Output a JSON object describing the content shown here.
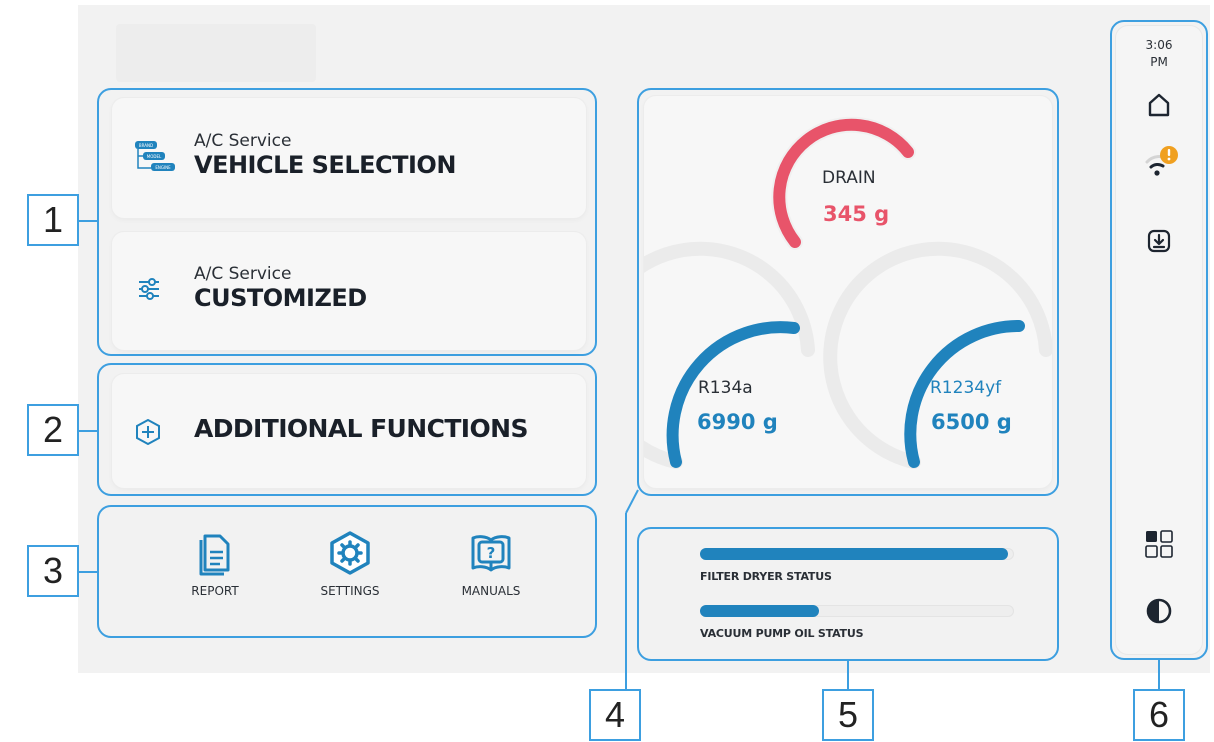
{
  "vehicle_selection": {
    "subtitle": "A/C Service",
    "title": "VEHICLE SELECTION",
    "icon": "vehicle-database-icon",
    "icon_tags": [
      "BRAND",
      "MODEL",
      "ENGINE"
    ]
  },
  "customized": {
    "subtitle": "A/C Service",
    "title": "CUSTOMIZED",
    "icon": "sliders-icon"
  },
  "additional": {
    "title": "ADDITIONAL FUNCTIONS",
    "icon": "plus-hexagon-icon"
  },
  "tools": [
    {
      "label": "REPORT",
      "icon": "document-icon"
    },
    {
      "label": "SETTINGS",
      "icon": "gear-hexagon-icon"
    },
    {
      "label": "MANUALS",
      "icon": "manual-book-icon"
    }
  ],
  "gauges": {
    "drain": {
      "label": "DRAIN",
      "value": "345 g",
      "color": "#e8546a",
      "level": 0.5
    },
    "r134a": {
      "label": "R134a",
      "value": "6990 g",
      "color": "#2083bd",
      "level": 0.75
    },
    "r1234yf": {
      "label": "R1234yf",
      "value": "6500 g",
      "color": "#2083bd",
      "level": 0.75
    }
  },
  "status": {
    "filter_dryer": {
      "label": "FILTER DRYER STATUS",
      "level": 1.0
    },
    "vacuum_pump_oil": {
      "label": "VACUUM PUMP OIL STATUS",
      "level": 0.38
    }
  },
  "sidebar": {
    "time_hour": "3:06",
    "time_period": "PM",
    "icons": [
      "home-icon",
      "wifi-warning-icon",
      "download-icon",
      "apps-grid-icon",
      "contrast-icon"
    ],
    "warning_color": "#f0a020"
  },
  "callouts": [
    "1",
    "2",
    "3",
    "4",
    "5",
    "6"
  ],
  "colors": {
    "accent": "#3d9fe0",
    "primary_blue": "#2083bd",
    "drain_red": "#e8546a"
  }
}
